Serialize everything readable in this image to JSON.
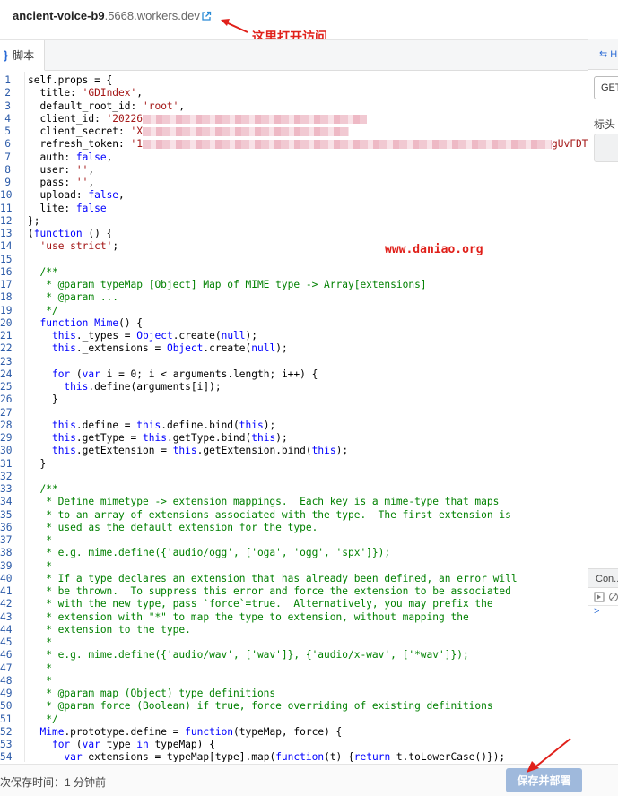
{
  "header": {
    "worker_name": "ancient-voice-b9",
    "worker_domain": ".5668.workers.dev",
    "open_icon": "external-link-icon"
  },
  "annotations": {
    "open_hint": "这里打开访问",
    "watermark": "www.daniao.org",
    "color": "#e0201a"
  },
  "editor": {
    "tab_label": "脚本",
    "tab_icon": "code-brackets-icon"
  },
  "right_panel": {
    "tab_fragment": "H",
    "method": "GET",
    "headers_label": "标头",
    "console_tab": "Con...",
    "console_prompt": ">"
  },
  "footer": {
    "saved_text": "次保存时间：1 分钟前",
    "save_button": "保存并部署"
  },
  "colors": {
    "keyword": "#0000ff",
    "string": "#a31515",
    "comment": "#008000",
    "line_number": "#2b5aa8",
    "save_button_bg": "#9fb9dc"
  },
  "code": [
    {
      "n": "1",
      "t": [
        [
          "p",
          "self.props = {"
        ]
      ]
    },
    {
      "n": "2",
      "t": [
        [
          "p",
          "  title: "
        ],
        [
          "s",
          "'GDIndex'"
        ],
        [
          "p",
          ","
        ]
      ]
    },
    {
      "n": "3",
      "t": [
        [
          "p",
          "  default_root_id: "
        ],
        [
          "s",
          "'root'"
        ],
        [
          "p",
          ","
        ]
      ]
    },
    {
      "n": "4",
      "t": [
        [
          "p",
          "  client_id: "
        ],
        [
          "s",
          "'20226"
        ],
        [
          "b",
          "250"
        ]
      ]
    },
    {
      "n": "5",
      "t": [
        [
          "p",
          "  client_secret: "
        ],
        [
          "s",
          "'X"
        ],
        [
          "b",
          "230"
        ]
      ]
    },
    {
      "n": "6",
      "t": [
        [
          "p",
          "  refresh_token: "
        ],
        [
          "s",
          "'1"
        ],
        [
          "b",
          "456"
        ],
        [
          "s",
          "gUvFDTE("
        ]
      ]
    },
    {
      "n": "7",
      "t": [
        [
          "p",
          "  auth: "
        ],
        [
          "k",
          "false"
        ],
        [
          "p",
          ","
        ]
      ]
    },
    {
      "n": "8",
      "t": [
        [
          "p",
          "  user: "
        ],
        [
          "s",
          "''"
        ],
        [
          "p",
          ","
        ]
      ]
    },
    {
      "n": "9",
      "t": [
        [
          "p",
          "  pass: "
        ],
        [
          "s",
          "''"
        ],
        [
          "p",
          ","
        ]
      ]
    },
    {
      "n": "10",
      "t": [
        [
          "p",
          "  upload: "
        ],
        [
          "k",
          "false"
        ],
        [
          "p",
          ","
        ]
      ]
    },
    {
      "n": "11",
      "t": [
        [
          "p",
          "  lite: "
        ],
        [
          "k",
          "false"
        ]
      ]
    },
    {
      "n": "12",
      "t": [
        [
          "p",
          "};"
        ]
      ]
    },
    {
      "n": "13",
      "t": [
        [
          "p",
          "("
        ],
        [
          "k",
          "function"
        ],
        [
          "p",
          " () {"
        ]
      ]
    },
    {
      "n": "14",
      "t": [
        [
          "p",
          "  "
        ],
        [
          "s",
          "'use strict'"
        ],
        [
          "p",
          ";"
        ]
      ]
    },
    {
      "n": "15",
      "t": []
    },
    {
      "n": "16",
      "t": [
        [
          "c",
          "  /**"
        ]
      ]
    },
    {
      "n": "17",
      "t": [
        [
          "c",
          "   * @param typeMap [Object] Map of MIME type -> Array[extensions]"
        ]
      ]
    },
    {
      "n": "18",
      "t": [
        [
          "c",
          "   * @param ..."
        ]
      ]
    },
    {
      "n": "19",
      "t": [
        [
          "c",
          "   */"
        ]
      ]
    },
    {
      "n": "20",
      "t": [
        [
          "p",
          "  "
        ],
        [
          "k",
          "function"
        ],
        [
          "p",
          " "
        ],
        [
          "k",
          "Mime"
        ],
        [
          "p",
          "() {"
        ]
      ]
    },
    {
      "n": "21",
      "t": [
        [
          "p",
          "    "
        ],
        [
          "k",
          "this"
        ],
        [
          "p",
          "._types = "
        ],
        [
          "k",
          "Object"
        ],
        [
          "p",
          ".create("
        ],
        [
          "k",
          "null"
        ],
        [
          "p",
          ");"
        ]
      ]
    },
    {
      "n": "22",
      "t": [
        [
          "p",
          "    "
        ],
        [
          "k",
          "this"
        ],
        [
          "p",
          "._extensions = "
        ],
        [
          "k",
          "Object"
        ],
        [
          "p",
          ".create("
        ],
        [
          "k",
          "null"
        ],
        [
          "p",
          ");"
        ]
      ]
    },
    {
      "n": "23",
      "t": []
    },
    {
      "n": "24",
      "t": [
        [
          "p",
          "    "
        ],
        [
          "k",
          "for"
        ],
        [
          "p",
          " ("
        ],
        [
          "k",
          "var"
        ],
        [
          "p",
          " i = 0; i < arguments.length; i++) {"
        ]
      ]
    },
    {
      "n": "25",
      "t": [
        [
          "p",
          "      "
        ],
        [
          "k",
          "this"
        ],
        [
          "p",
          ".define(arguments[i]);"
        ]
      ]
    },
    {
      "n": "26",
      "t": [
        [
          "p",
          "    }"
        ]
      ]
    },
    {
      "n": "27",
      "t": []
    },
    {
      "n": "28",
      "t": [
        [
          "p",
          "    "
        ],
        [
          "k",
          "this"
        ],
        [
          "p",
          ".define = "
        ],
        [
          "k",
          "this"
        ],
        [
          "p",
          ".define.bind("
        ],
        [
          "k",
          "this"
        ],
        [
          "p",
          ");"
        ]
      ]
    },
    {
      "n": "29",
      "t": [
        [
          "p",
          "    "
        ],
        [
          "k",
          "this"
        ],
        [
          "p",
          ".getType = "
        ],
        [
          "k",
          "this"
        ],
        [
          "p",
          ".getType.bind("
        ],
        [
          "k",
          "this"
        ],
        [
          "p",
          ");"
        ]
      ]
    },
    {
      "n": "30",
      "t": [
        [
          "p",
          "    "
        ],
        [
          "k",
          "this"
        ],
        [
          "p",
          ".getExtension = "
        ],
        [
          "k",
          "this"
        ],
        [
          "p",
          ".getExtension.bind("
        ],
        [
          "k",
          "this"
        ],
        [
          "p",
          ");"
        ]
      ]
    },
    {
      "n": "31",
      "t": [
        [
          "p",
          "  }"
        ]
      ]
    },
    {
      "n": "32",
      "t": []
    },
    {
      "n": "33",
      "t": [
        [
          "c",
          "  /**"
        ]
      ]
    },
    {
      "n": "34",
      "t": [
        [
          "c",
          "   * Define mimetype -> extension mappings.  Each key is a mime-type that maps"
        ]
      ]
    },
    {
      "n": "35",
      "t": [
        [
          "c",
          "   * to an array of extensions associated with the type.  The first extension is"
        ]
      ]
    },
    {
      "n": "36",
      "t": [
        [
          "c",
          "   * used as the default extension for the type."
        ]
      ]
    },
    {
      "n": "37",
      "t": [
        [
          "c",
          "   *"
        ]
      ]
    },
    {
      "n": "38",
      "t": [
        [
          "c",
          "   * e.g. mime.define({'audio/ogg', ['oga', 'ogg', 'spx']});"
        ]
      ]
    },
    {
      "n": "39",
      "t": [
        [
          "c",
          "   *"
        ]
      ]
    },
    {
      "n": "40",
      "t": [
        [
          "c",
          "   * If a type declares an extension that has already been defined, an error will"
        ]
      ]
    },
    {
      "n": "41",
      "t": [
        [
          "c",
          "   * be thrown.  To suppress this error and force the extension to be associated"
        ]
      ]
    },
    {
      "n": "42",
      "t": [
        [
          "c",
          "   * with the new type, pass `force`=true.  Alternatively, you may prefix the"
        ]
      ]
    },
    {
      "n": "43",
      "t": [
        [
          "c",
          "   * extension with \"*\" to map the type to extension, without mapping the"
        ]
      ]
    },
    {
      "n": "44",
      "t": [
        [
          "c",
          "   * extension to the type."
        ]
      ]
    },
    {
      "n": "45",
      "t": [
        [
          "c",
          "   *"
        ]
      ]
    },
    {
      "n": "46",
      "t": [
        [
          "c",
          "   * e.g. mime.define({'audio/wav', ['wav']}, {'audio/x-wav', ['*wav']});"
        ]
      ]
    },
    {
      "n": "47",
      "t": [
        [
          "c",
          "   *"
        ]
      ]
    },
    {
      "n": "48",
      "t": [
        [
          "c",
          "   *"
        ]
      ]
    },
    {
      "n": "49",
      "t": [
        [
          "c",
          "   * @param map (Object) type definitions"
        ]
      ]
    },
    {
      "n": "50",
      "t": [
        [
          "c",
          "   * @param force (Boolean) if true, force overriding of existing definitions"
        ]
      ]
    },
    {
      "n": "51",
      "t": [
        [
          "c",
          "   */"
        ]
      ]
    },
    {
      "n": "52",
      "t": [
        [
          "p",
          "  "
        ],
        [
          "k",
          "Mime"
        ],
        [
          "p",
          ".prototype.define = "
        ],
        [
          "k",
          "function"
        ],
        [
          "p",
          "(typeMap, force) {"
        ]
      ]
    },
    {
      "n": "53",
      "t": [
        [
          "p",
          "    "
        ],
        [
          "k",
          "for"
        ],
        [
          "p",
          " ("
        ],
        [
          "k",
          "var"
        ],
        [
          "p",
          " type "
        ],
        [
          "k",
          "in"
        ],
        [
          "p",
          " typeMap) {"
        ]
      ]
    },
    {
      "n": "54",
      "t": [
        [
          "p",
          "      "
        ],
        [
          "k",
          "var"
        ],
        [
          "p",
          " extensions = typeMap[type].map("
        ],
        [
          "k",
          "function"
        ],
        [
          "p",
          "(t) {"
        ],
        [
          "k",
          "return"
        ],
        [
          "p",
          " t.toLowerCase()});"
        ]
      ]
    }
  ]
}
